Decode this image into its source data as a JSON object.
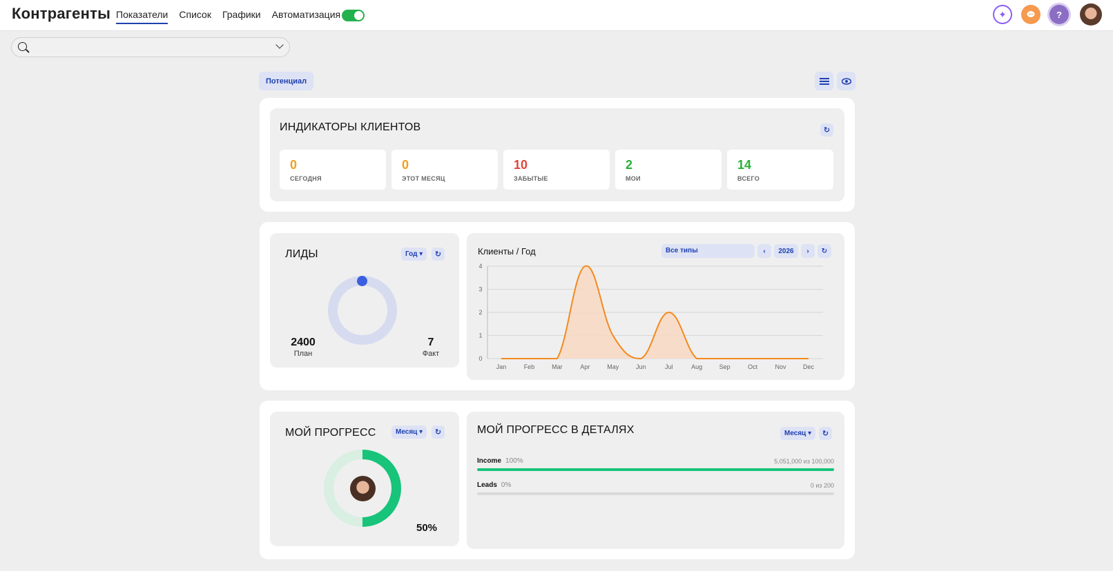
{
  "app": {
    "title": "Контрагенты",
    "nav": [
      "Показатели",
      "Список",
      "Графики",
      "Автоматизация"
    ],
    "active_nav": "Показатели",
    "toggle_on": true
  },
  "top_icons": {
    "help": "?"
  },
  "potential_button": "Потенциал",
  "indicators": {
    "title": "ИНДИКАТОРЫ КЛИЕНТОВ",
    "items": [
      {
        "value": "0",
        "label": "СЕГОДНЯ",
        "color": "#f0a020"
      },
      {
        "value": "0",
        "label": "ЭТОТ МЕСЯЦ",
        "color": "#f0a020"
      },
      {
        "value": "10",
        "label": "ЗАБЫТЫЕ",
        "color": "#e0453a"
      },
      {
        "value": "2",
        "label": "МОИ",
        "color": "#2ab035"
      },
      {
        "value": "14",
        "label": "ВСЕГО",
        "color": "#2ab035"
      }
    ]
  },
  "leads": {
    "title": "ЛИДЫ",
    "period": "Год",
    "plan_value": "2400",
    "plan_label": "План",
    "fact_value": "7",
    "fact_label": "Факт"
  },
  "clients_chart": {
    "title": "Клиенты / Год",
    "type_filter": "Все типы",
    "prev": "‹",
    "year": "2026",
    "next": "›"
  },
  "chart_data": {
    "type": "area",
    "categories": [
      "Jan",
      "Feb",
      "Mar",
      "Apr",
      "May",
      "Jun",
      "Jul",
      "Aug",
      "Sep",
      "Oct",
      "Nov",
      "Dec"
    ],
    "values": [
      0,
      0,
      0,
      4,
      1,
      0,
      2,
      0,
      0,
      0,
      0,
      0
    ],
    "ylim": [
      0,
      4
    ],
    "yticks": [
      "0",
      "1",
      "2",
      "3",
      "4"
    ],
    "line_color": "#f28a1e",
    "fill_color": "#f7d9c4",
    "grid": true
  },
  "my_progress": {
    "title": "МОЙ ПРОГРЕСС",
    "period": "Месяц",
    "percent_label": "50%",
    "percent": 50
  },
  "progress_details": {
    "title": "МОЙ ПРОГРЕСС В ДЕТАЛЯХ",
    "period": "Месяц",
    "rows": [
      {
        "name": "Income",
        "pct": "100%",
        "right": "5,051,000 из 100,000",
        "fill": 1.0
      },
      {
        "name": "Leads",
        "pct": "0%",
        "right": "0 из 200",
        "fill": 0
      }
    ]
  }
}
